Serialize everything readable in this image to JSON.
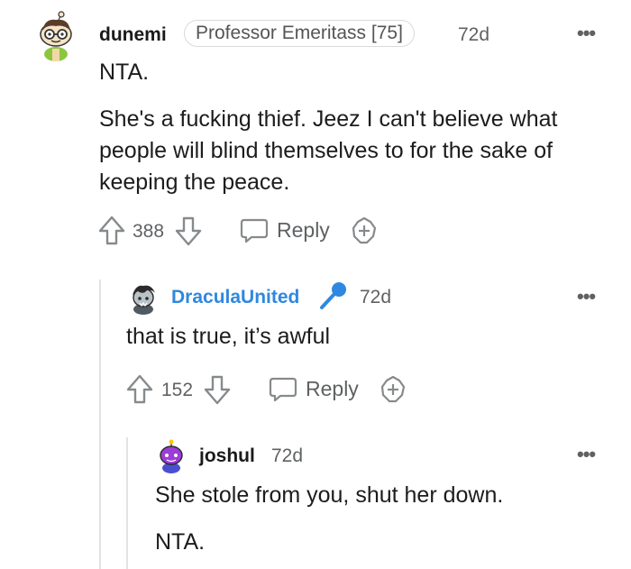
{
  "comments": [
    {
      "user": "dunemi",
      "flair": "Professor Emeritass [75]",
      "time": "72d",
      "more": "•••",
      "paragraphs": [
        "NTA.",
        "She's a fucking thief. Jeez I can't believe what people will blind themselves to for the sake of keeping the peace."
      ],
      "votes": "388",
      "reply_label": "Reply"
    },
    {
      "user": "DraculaUnited",
      "time": "72d",
      "more": "•••",
      "paragraphs": [
        "that is true, it’s awful"
      ],
      "votes": "152",
      "reply_label": "Reply"
    },
    {
      "user": "joshul",
      "time": "72d",
      "more": "•••",
      "paragraphs": [
        "She stole from you, shut her down.",
        "NTA."
      ]
    }
  ],
  "colors": {
    "op_username": "#2f88e0",
    "text": "#1c1c1c",
    "meta": "#5f6163",
    "thread_line": "#e2e3e5"
  }
}
